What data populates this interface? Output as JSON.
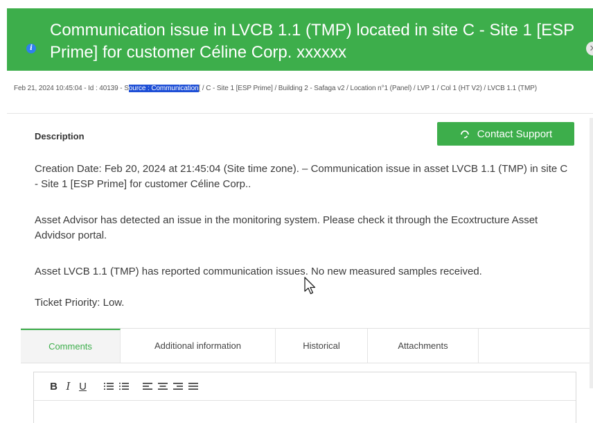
{
  "header": {
    "title": "Communication issue in LVCB 1.1 (TMP) located in site C - Site 1 [ESP Prime] for customer Céline Corp. xxxxxx",
    "info_icon": "info-icon",
    "close_icon": "close-icon",
    "color": "#3dae4b"
  },
  "breadcrumb": {
    "prefix": "Feb 21, 2024 10:45:04 - Id : 40139 - S",
    "highlight": "ource : Communication",
    "rest": "[ / C - Site 1 [ESP Prime] / Building 2 - Safaga v2 / Location n°1 (Panel) / LVP 1 / Col 1 (HT V2) / LVCB 1.1 (TMP)"
  },
  "description": {
    "label": "Description",
    "support_button": "Contact Support",
    "support_icon": "headset-icon",
    "paragraphs": [
      "Creation Date: Feb 20, 2024 at 21:45:04 (Site time zone). – Communication issue in asset LVCB 1.1 (TMP) in site C - Site 1 [ESP Prime] for customer Céline Corp..",
      "Asset Advisor has detected an issue in the monitoring system. Please check it through the Ecoxtructure Asset Advidsor portal.",
      "Asset LVCB 1.1 (TMP) has reported communication issues. No new measured samples received.",
      "Ticket Priority:  Low."
    ]
  },
  "tabs": [
    {
      "label": "Comments",
      "active": true
    },
    {
      "label": "Additional information",
      "active": false
    },
    {
      "label": "Historical",
      "active": false
    },
    {
      "label": "Attachments",
      "active": false
    }
  ],
  "editor_toolbar": {
    "bold": "B",
    "italic": "I",
    "underline": "U",
    "icons": [
      "ordered-list-icon",
      "bullet-list-icon",
      "align-left-icon",
      "align-center-icon",
      "align-right-icon",
      "align-justify-icon"
    ]
  }
}
